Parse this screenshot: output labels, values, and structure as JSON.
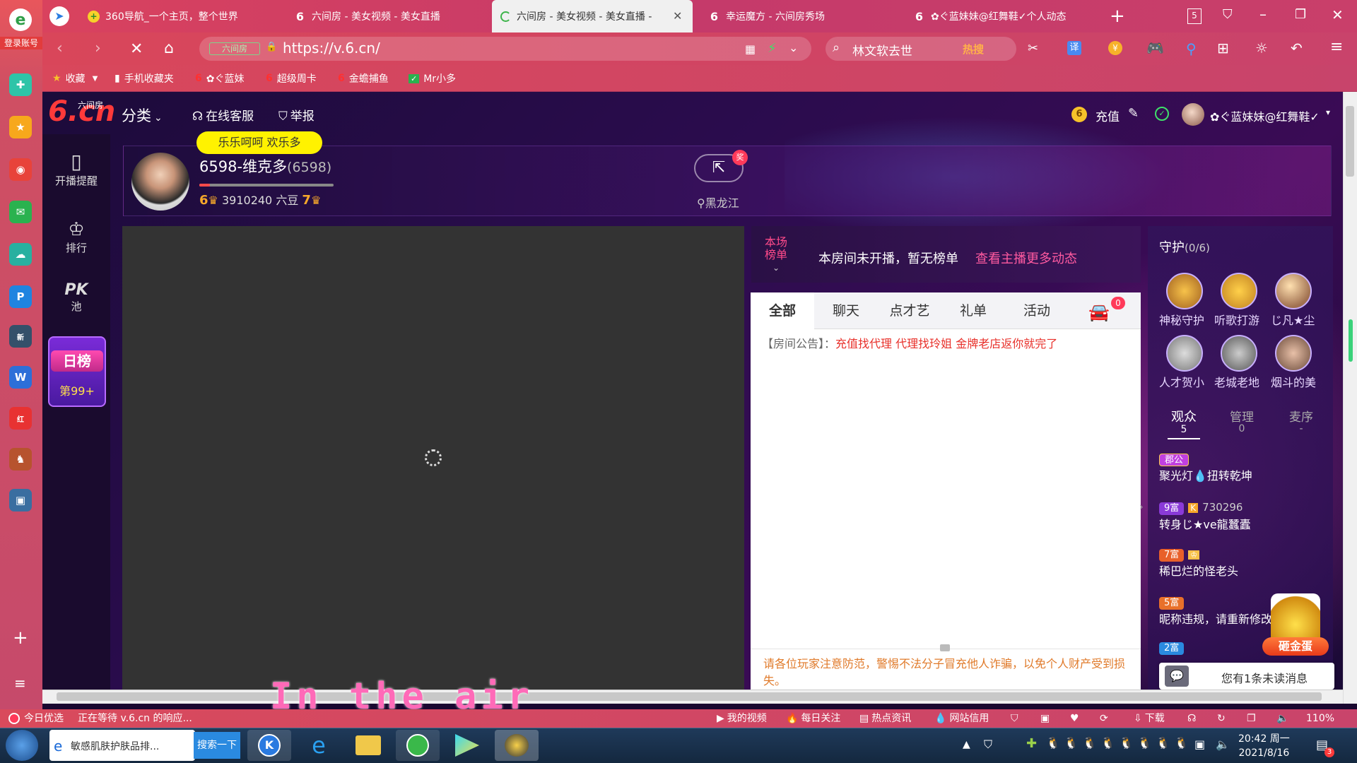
{
  "sidebar_left": {
    "login_label": "登录账号"
  },
  "tabs": [
    {
      "title": "360导航_一个主页，整个世界",
      "icon": "360-icon"
    },
    {
      "title": "六间房 - 美女视频 - 美女直播",
      "icon": "6cn-icon"
    },
    {
      "title": "六间房 - 美女视频 - 美女直播 -",
      "icon": "loading-icon",
      "active": true
    },
    {
      "title": "幸运魔方 - 六间房秀场",
      "icon": "6cn-icon"
    },
    {
      "title": "✿ぐ蓝妹妹@红舞鞋✓个人动态",
      "icon": "6cn-icon"
    }
  ],
  "tab_count": "5",
  "address": {
    "badge": "六间房",
    "url": "https://v.6.cn/"
  },
  "search": {
    "query": "林文软去世",
    "hot_label": "热搜"
  },
  "bookmarks": [
    {
      "label": "收藏"
    },
    {
      "label": "手机收藏夹"
    },
    {
      "label": "✿ぐ蓝妹"
    },
    {
      "label": "超级周卡"
    },
    {
      "label": "金蟾捕鱼"
    },
    {
      "label": "Mr小多"
    }
  ],
  "site_header": {
    "logo_text": "6.cn",
    "logo_sub": "六间房",
    "category": "分类",
    "service": "在线客服",
    "report": "举报",
    "recharge": "充值",
    "username": "✿ぐ蓝妹妹@红舞鞋✓"
  },
  "left_nav": {
    "remind": "开播提醒",
    "rank": "排行",
    "pk_title": "PK",
    "pk_sub": "池",
    "daily_title": "日榜",
    "daily_rank": "第99+"
  },
  "streamer": {
    "tag": "乐乐呵呵 欢乐多",
    "name": "6598-维克多",
    "room_id": "(6598)",
    "level_left": "6",
    "beans": "3910240 六豆",
    "level_right": "7",
    "location": "黑龙江",
    "share_badge": "奖"
  },
  "rank_panel": {
    "label_line1": "本场",
    "label_line2": "榜单",
    "message": "本房间未开播，暂无榜单",
    "link": "查看主播更多动态"
  },
  "chat_tabs": [
    "全部",
    "聊天",
    "点才艺",
    "礼单",
    "活动"
  ],
  "car_count": "0",
  "chat": {
    "announce_label": "【房间公告】：",
    "announce_text": "充值找代理 代理找玲姐 金牌老店返你就完了",
    "warning": "请各位玩家注意防范，警惕不法分子冒充他人诈骗，以免个人财产受到损失。"
  },
  "guard": {
    "title": "守护",
    "count": "(0/6)",
    "members": [
      "神秘守护",
      "听歌打游",
      "じ凡★尘",
      "人才贺小",
      "老城老地",
      "烟斗的美"
    ]
  },
  "audience_tabs": [
    {
      "label": "观众",
      "count": "5"
    },
    {
      "label": "管理",
      "count": "0"
    },
    {
      "label": "麦序",
      "count": "-"
    }
  ],
  "audience": [
    {
      "badge": "郡公",
      "name": "聚光灯💧扭转乾坤",
      "extra": ""
    },
    {
      "badge": "9富",
      "name": "转身じ★ve龍蠶蠹",
      "extra": "730296"
    },
    {
      "badge": "7富",
      "name": "稀巴烂的怪老头",
      "extra": ""
    },
    {
      "badge": "5富",
      "name": "昵称违规，请重新修改",
      "extra": ""
    },
    {
      "badge": "2富",
      "name": "",
      "extra": ""
    }
  ],
  "egg_label": "砸金蛋",
  "unread_msg": "您有1条未读消息",
  "subtitle_overlay": "In the air",
  "status_bar": {
    "left_label": "今日优选",
    "waiting": "正在等待 v.6.cn 的响应...",
    "items": [
      "我的视频",
      "每日关注",
      "热点资讯",
      "网站信用",
      "下载"
    ],
    "zoom": "110%"
  },
  "taskbar": {
    "task1": "敏感肌肤护肤品排...",
    "task1_btn": "搜索一下",
    "time": "20:42 周一",
    "date": "2021/8/16",
    "notify_count": "3"
  }
}
